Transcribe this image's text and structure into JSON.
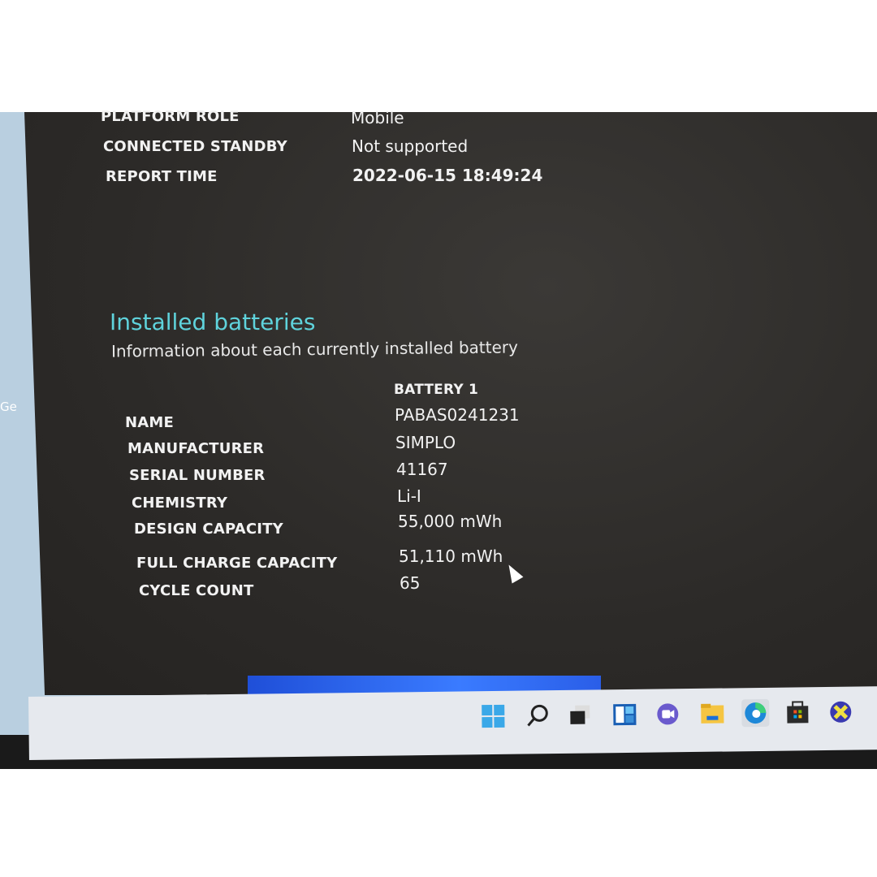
{
  "system_info": [
    {
      "label": "PLATFORM ROLE",
      "value": "Mobile"
    },
    {
      "label": "CONNECTED STANDBY",
      "value": "Not supported"
    },
    {
      "label": "REPORT TIME",
      "value": "2022-06-15  18:49:24"
    }
  ],
  "batteries": {
    "title": "Installed batteries",
    "subtitle": "Information about each currently installed battery",
    "column_header": "BATTERY 1",
    "rows": [
      {
        "label": "NAME",
        "value": "PABAS0241231"
      },
      {
        "label": "MANUFACTURER",
        "value": "SIMPLO"
      },
      {
        "label": "SERIAL NUMBER",
        "value": "41167"
      },
      {
        "label": "CHEMISTRY",
        "value": "Li-I"
      },
      {
        "label": "DESIGN CAPACITY",
        "value": "55,000 mWh"
      },
      {
        "label": "FULL CHARGE CAPACITY",
        "value": "51,110 mWh"
      },
      {
        "label": "CYCLE COUNT",
        "value": "65"
      }
    ]
  },
  "background_window_text": "Ge",
  "accent_color": "#5fd3dc",
  "taskbar": {
    "icons": [
      "start-icon",
      "search-icon",
      "task-view-icon",
      "widgets-icon",
      "chat-icon",
      "file-explorer-icon",
      "edge-icon",
      "store-icon",
      "app-x-icon"
    ],
    "active": "edge-icon"
  }
}
